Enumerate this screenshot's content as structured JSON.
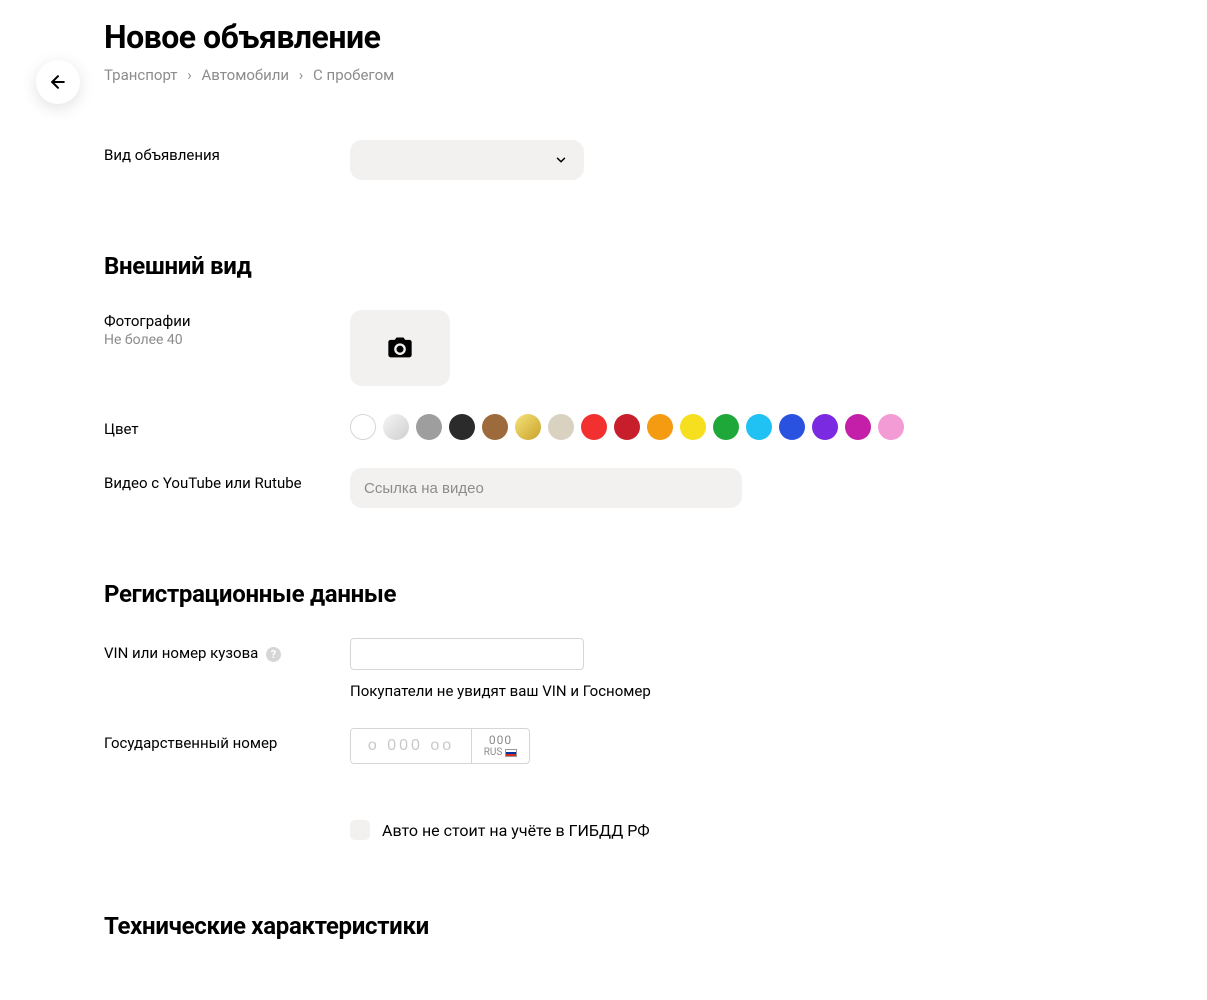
{
  "page_title": "Новое объявление",
  "breadcrumb": [
    "Транспорт",
    "Автомобили",
    "С пробегом"
  ],
  "ad_type": {
    "label": "Вид объявления"
  },
  "sections": {
    "appearance": {
      "title": "Внешний вид",
      "photos": {
        "label": "Фотографии",
        "hint": "Не более 40"
      },
      "color": {
        "label": "Цвет",
        "swatches": [
          {
            "name": "white",
            "value": "#ffffff",
            "outlined": true
          },
          {
            "name": "silver",
            "value": "linear-gradient(135deg,#f5f5f5,#cfcfcf)"
          },
          {
            "name": "gray",
            "value": "#9e9e9e"
          },
          {
            "name": "black",
            "value": "#2b2b2b"
          },
          {
            "name": "brown",
            "value": "#9c6a3b"
          },
          {
            "name": "gold",
            "value": "linear-gradient(135deg,#f6e27a,#c9a22a)"
          },
          {
            "name": "beige",
            "value": "#d9d2c1"
          },
          {
            "name": "red",
            "value": "#f23030"
          },
          {
            "name": "darkred",
            "value": "#c81e2b"
          },
          {
            "name": "orange",
            "value": "#f59b11"
          },
          {
            "name": "yellow",
            "value": "#f5df1f"
          },
          {
            "name": "green",
            "value": "#1fa83a"
          },
          {
            "name": "cyan",
            "value": "#1fc2f2"
          },
          {
            "name": "blue",
            "value": "#2a52e0"
          },
          {
            "name": "violet",
            "value": "#7a2ae0"
          },
          {
            "name": "magenta",
            "value": "#c41fa8"
          },
          {
            "name": "pink",
            "value": "#f29bd4"
          }
        ]
      },
      "video": {
        "label": "Видео с YouTube или Rutube",
        "placeholder": "Ссылка на видео"
      }
    },
    "registration": {
      "title": "Регистрационные данные",
      "vin": {
        "label": "VIN или номер кузова",
        "hint": "Покупатели не увидят ваш VIN и Госномер"
      },
      "gosnomer": {
        "label": "Государственный номер",
        "plate_placeholder": "о 000 оо",
        "region_placeholder": "000",
        "rus_label": "RUS"
      },
      "not_registered": {
        "label": "Авто не стоит на учёте в ГИБДД РФ"
      }
    },
    "tech": {
      "title": "Технические характеристики"
    }
  }
}
